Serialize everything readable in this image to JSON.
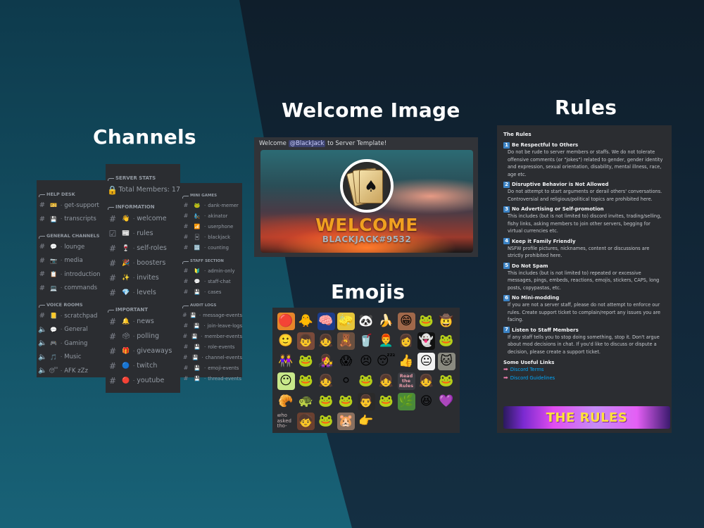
{
  "titles": {
    "channels": "Channels",
    "welcome": "Welcome Image",
    "emojis": "Emojis",
    "rules": "Rules"
  },
  "channels": {
    "panel1": [
      {
        "category": "HELP DESK",
        "items": [
          {
            "type": "text",
            "emoji": "🎫",
            "name": "get-support"
          },
          {
            "type": "text-locked",
            "emoji": "💾",
            "name": "transcripts"
          }
        ]
      },
      {
        "category": "GENERAL CHANNELS",
        "items": [
          {
            "type": "text",
            "emoji": "💬",
            "name": "lounge"
          },
          {
            "type": "text",
            "emoji": "📷",
            "name": "media"
          },
          {
            "type": "text",
            "emoji": "📋",
            "name": "introduction"
          },
          {
            "type": "text",
            "emoji": "💻",
            "name": "commands"
          }
        ]
      },
      {
        "category": "VOICE ROOMS",
        "items": [
          {
            "type": "text",
            "emoji": "📒",
            "name": "scratchpad"
          },
          {
            "type": "voice",
            "emoji": "💬",
            "name": "General"
          },
          {
            "type": "voice",
            "emoji": "🎮",
            "name": "Gaming"
          },
          {
            "type": "voice",
            "emoji": "🎵",
            "name": "Music"
          },
          {
            "type": "voice",
            "emoji": "😴",
            "name": "AFK zZz"
          }
        ]
      }
    ],
    "panel2": [
      {
        "category": "SERVER STATS",
        "items": [
          {
            "type": "locked-voice",
            "emoji": "",
            "name": "Total Members: 17"
          }
        ]
      },
      {
        "category": "INFORMATION",
        "items": [
          {
            "type": "text",
            "emoji": "👋",
            "name": "welcome"
          },
          {
            "type": "rules",
            "emoji": "📰",
            "name": "rules"
          },
          {
            "type": "text",
            "emoji": "🍷",
            "name": "self-roles"
          },
          {
            "type": "text",
            "emoji": "🎉",
            "name": "boosters"
          },
          {
            "type": "text",
            "emoji": "✨",
            "name": "invites"
          },
          {
            "type": "text",
            "emoji": "💎",
            "name": "levels"
          }
        ]
      },
      {
        "category": "IMPORTANT",
        "items": [
          {
            "type": "text",
            "emoji": "🔔",
            "name": "news"
          },
          {
            "type": "text",
            "emoji": "🗳",
            "name": "polling"
          },
          {
            "type": "text",
            "emoji": "🎁",
            "name": "giveaways"
          },
          {
            "type": "text",
            "emoji": "🔵",
            "name": "twitch"
          },
          {
            "type": "text",
            "emoji": "🔴",
            "name": "youtube"
          }
        ]
      }
    ],
    "panel3": [
      {
        "category": "MINI GAMES",
        "items": [
          {
            "type": "text-locked",
            "emoji": "🐸",
            "name": "dank-memer"
          },
          {
            "type": "text-locked",
            "emoji": "🧞",
            "name": "akinator"
          },
          {
            "type": "text-locked",
            "emoji": "📶",
            "name": "userphone"
          },
          {
            "type": "text-locked",
            "emoji": "🃏",
            "name": "blackjack"
          },
          {
            "type": "text-locked",
            "emoji": "🔢",
            "name": "counting"
          }
        ]
      },
      {
        "category": "STAFF SECTION",
        "items": [
          {
            "type": "text-locked",
            "emoji": "🔰",
            "name": "admin-only"
          },
          {
            "type": "text-locked",
            "emoji": "💬",
            "name": "staff-chat"
          },
          {
            "type": "text-locked",
            "emoji": "💾",
            "name": "cases"
          }
        ]
      },
      {
        "category": "AUDIT LOGS",
        "items": [
          {
            "type": "text-locked",
            "emoji": "💾",
            "name": "message-events"
          },
          {
            "type": "text-locked",
            "emoji": "💾",
            "name": "join-leave-logs"
          },
          {
            "type": "text-locked",
            "emoji": "💾",
            "name": "member-events"
          },
          {
            "type": "text-locked",
            "emoji": "💾",
            "name": "role-events"
          },
          {
            "type": "text-locked",
            "emoji": "💾",
            "name": "channel-events"
          },
          {
            "type": "text-locked",
            "emoji": "💾",
            "name": "emoji-events"
          },
          {
            "type": "text-locked",
            "emoji": "💾",
            "name": "thread-events"
          }
        ]
      }
    ]
  },
  "welcome": {
    "message_prefix": "Welcome ",
    "mention": "@BlackJack",
    "message_suffix": " to Server Template!",
    "banner_title": "WELCOME",
    "banner_user": "BLACKJACK#9532"
  },
  "emojis": [
    {
      "g": "🔴",
      "bg": "#e8862a"
    },
    {
      "g": "🐥",
      "bg": ""
    },
    {
      "g": "🧠",
      "bg": "#1c3c8a"
    },
    {
      "g": "🧽",
      "bg": "#e6c53a"
    },
    {
      "g": "🐼",
      "bg": ""
    },
    {
      "g": "🍌",
      "bg": ""
    },
    {
      "g": "😁",
      "bg": "#a0684a"
    },
    {
      "g": "🐸",
      "bg": ""
    },
    {
      "g": "🤠",
      "bg": ""
    },
    {
      "g": "🙂",
      "bg": ""
    },
    {
      "g": "👦",
      "bg": "#7a4a3a"
    },
    {
      "g": "👧",
      "bg": ""
    },
    {
      "g": "🧸",
      "bg": "#6a5040"
    },
    {
      "g": "🥤",
      "bg": ""
    },
    {
      "g": "👨‍🦰",
      "bg": ""
    },
    {
      "g": "👩",
      "bg": ""
    },
    {
      "g": "👻",
      "bg": "#111111"
    },
    {
      "g": "🐸",
      "bg": ""
    },
    {
      "g": "👭",
      "bg": ""
    },
    {
      "g": "🐸",
      "bg": ""
    },
    {
      "g": "👩‍🎤",
      "bg": ""
    },
    {
      "g": "😱",
      "bg": ""
    },
    {
      "g": "😣",
      "bg": ""
    },
    {
      "g": "😴",
      "bg": ""
    },
    {
      "g": "👍",
      "bg": ""
    },
    {
      "g": "😐",
      "bg": "#f2f2f2"
    },
    {
      "g": "🐱",
      "bg": "#8a8a80"
    },
    {
      "g": "😶",
      "bg": "#c8e88a"
    },
    {
      "g": "🐸",
      "bg": ""
    },
    {
      "g": "👧",
      "bg": ""
    },
    {
      "g": "⚪",
      "bg": ""
    },
    {
      "g": "🐸",
      "bg": ""
    },
    {
      "g": "👧",
      "bg": ""
    },
    {
      "g": "Read the Rules",
      "bg": "",
      "kind": "rtr"
    },
    {
      "g": "👧",
      "bg": ""
    },
    {
      "g": "🐸",
      "bg": ""
    },
    {
      "g": "🥐",
      "bg": ""
    },
    {
      "g": "🐢",
      "bg": ""
    },
    {
      "g": "🐸",
      "bg": ""
    },
    {
      "g": "🐸",
      "bg": ""
    },
    {
      "g": "👨",
      "bg": "#2a2a2a"
    },
    {
      "g": "🐸",
      "bg": ""
    },
    {
      "g": "🌿",
      "bg": "#4a8a3a"
    },
    {
      "g": "😆",
      "bg": ""
    },
    {
      "g": "💜",
      "bg": ""
    },
    {
      "g": "who asked tho-",
      "bg": "",
      "kind": "text"
    },
    {
      "g": "🧒",
      "bg": "#6a4030"
    },
    {
      "g": "🐸",
      "bg": ""
    },
    {
      "g": "🐹",
      "bg": "#8a7060"
    },
    {
      "g": "👉",
      "bg": ""
    }
  ],
  "rules": {
    "heading": "The Rules",
    "items": [
      {
        "num": "1",
        "title": "Be Respectful to Others",
        "body": "Do not be rude to server members or staffs. We do not tolerate offensive comments (or \"jokes\") related to gender, gender identity and expression, sexual orientation, disability, mental illness, race, age etc."
      },
      {
        "num": "2",
        "title": "Disruptive Behavior is Not Allowed",
        "body": "Do not attempt to start arguments or derail others' conversations. Controversial and religious/political topics are prohibited here."
      },
      {
        "num": "3",
        "title": "No Advertising or Self-promotion",
        "body": "This includes (but is not limited to) discord invites, trading/selling, fishy links, asking members to join other servers, begging for virtual currencies etc."
      },
      {
        "num": "4",
        "title": "Keep it Family Friendly",
        "body": "NSFW profile pictures, nicknames, content or discussions are strictly prohibited here."
      },
      {
        "num": "5",
        "title": "Do Not Spam",
        "body": "This includes (but is not limited to) repeated or excessive messages, pings, embeds, reactions, emojis, stickers, CAPS, long posts, copypastas, etc."
      },
      {
        "num": "6",
        "title": "No Mini-modding",
        "body": "If you are not a server staff, please do not attempt to enforce our rules. Create support ticket to complain/report any issues you are facing."
      },
      {
        "num": "7",
        "title": "Listen to Staff Members",
        "body": "If any staff tells you to stop doing something, stop it. Don't argue about mod decisions in chat. If you'd like to discuss or dispute a decision, please create a support ticket."
      }
    ],
    "links_heading": "Some Useful Links",
    "links": [
      "Discord Terms",
      "Discord Guidelines"
    ],
    "banner": "THE RULES"
  },
  "colors": {
    "panel_bg": "#2b2d31",
    "muted_text": "#949ba4",
    "link": "#00a8fc",
    "number_badge": "#3b82c4",
    "welcome_orange": "#f0a020",
    "banner_yellow": "#ffe23a"
  }
}
